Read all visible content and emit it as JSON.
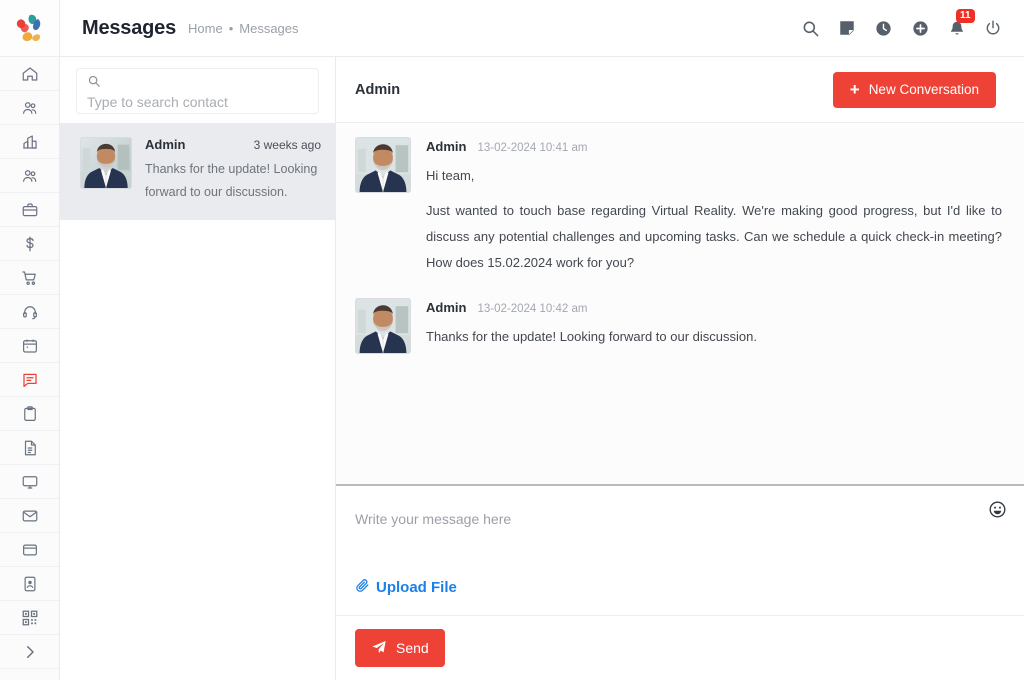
{
  "brand": {
    "accent_red": "#ee4237",
    "link_blue": "#1b7fea",
    "sidebar_active": "#ef4036",
    "logo_colors": [
      "#e8413a",
      "#2f9e9a",
      "#f0a93b",
      "#3f6fb5"
    ],
    "logo_name": "app-logo"
  },
  "header": {
    "title": "Messages",
    "breadcrumb": {
      "home": "Home",
      "separator": "•",
      "current": "Messages"
    },
    "icons": [
      {
        "name": "search-icon",
        "label": "Search"
      },
      {
        "name": "note-icon",
        "label": "Notes"
      },
      {
        "name": "clock-icon",
        "label": "Recent"
      },
      {
        "name": "plus-circle-icon",
        "label": "Add"
      },
      {
        "name": "bell-icon",
        "label": "Notifications",
        "badge": "11"
      },
      {
        "name": "power-icon",
        "label": "Logout"
      }
    ]
  },
  "sidebar": {
    "items": [
      {
        "name": "home-icon",
        "label": "Dashboard",
        "active": false
      },
      {
        "name": "users-icon",
        "label": "Contacts",
        "active": false
      },
      {
        "name": "building-icon",
        "label": "Companies",
        "active": false
      },
      {
        "name": "team-icon",
        "label": "Leads",
        "active": false
      },
      {
        "name": "briefcase-icon",
        "label": "Projects",
        "active": false
      },
      {
        "name": "dollar-icon",
        "label": "Finance",
        "active": false
      },
      {
        "name": "cart-icon",
        "label": "Orders",
        "active": false
      },
      {
        "name": "headset-icon",
        "label": "Support",
        "active": false
      },
      {
        "name": "calendar-icon",
        "label": "Calendar",
        "active": false
      },
      {
        "name": "chat-icon",
        "label": "Messages",
        "active": true
      },
      {
        "name": "clipboard-icon",
        "label": "Tasks",
        "active": false
      },
      {
        "name": "document-icon",
        "label": "Documents",
        "active": false
      },
      {
        "name": "monitor-icon",
        "label": "Reports",
        "active": false
      },
      {
        "name": "envelope-icon",
        "label": "Mail",
        "active": false
      },
      {
        "name": "window-icon",
        "label": "Pages",
        "active": false
      },
      {
        "name": "id-card-icon",
        "label": "Profile",
        "active": false
      },
      {
        "name": "qr-code-icon",
        "label": "QR Code",
        "active": false
      },
      {
        "name": "chevron-right-icon",
        "label": "Expand",
        "active": false
      }
    ]
  },
  "contacts": {
    "search": {
      "placeholder": "Type to search contact",
      "value": ""
    },
    "list": [
      {
        "name": "Admin",
        "time": "3 weeks ago",
        "preview": "Thanks for the update! Looking forward to our discussion.",
        "selected": true
      }
    ]
  },
  "conversation": {
    "title": "Admin",
    "new_conversation_button": "New Conversation",
    "messages": [
      {
        "author": "Admin",
        "time": "13-02-2024 10:41 am",
        "lines": [
          "Hi team,",
          "Just wanted to touch base regarding Virtual Reality. We're making good progress, but I'd like to discuss any potential challenges and upcoming tasks. Can we schedule a quick check-in meeting? How does 15.02.2024 work for you?"
        ]
      },
      {
        "author": "Admin",
        "time": "13-02-2024 10:42 am",
        "lines": [
          "Thanks for the update! Looking forward to our discussion."
        ]
      }
    ]
  },
  "composer": {
    "placeholder": "Write your message here",
    "value": "",
    "emoji_icon": "smiley-icon",
    "upload_label": "Upload File",
    "send_label": "Send"
  }
}
